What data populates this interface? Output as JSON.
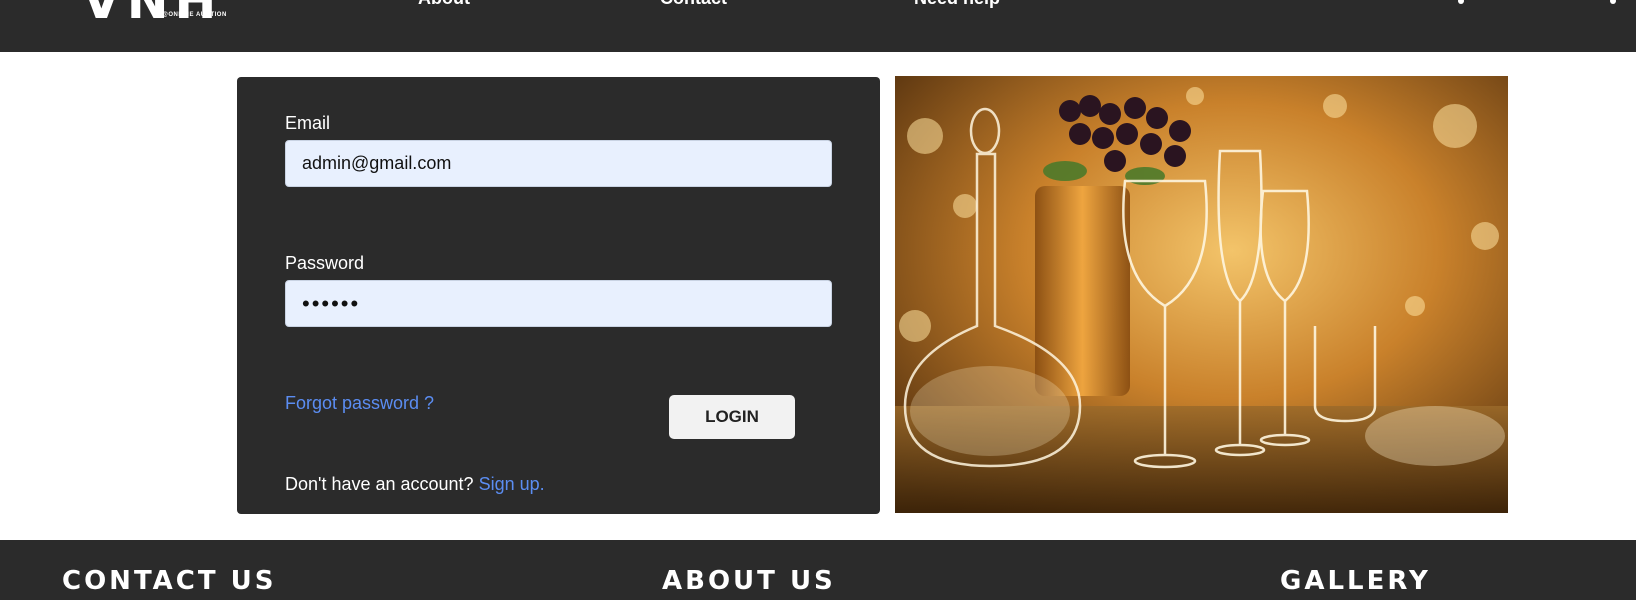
{
  "header": {
    "logo_text": "VNH",
    "logo_tagline": "@ONLINE AUCTION",
    "nav": [
      {
        "label": "About"
      },
      {
        "label": "Contact"
      },
      {
        "label": "Need help"
      }
    ]
  },
  "login_form": {
    "email_label": "Email",
    "email_value": "admin@gmail.com",
    "password_label": "Password",
    "password_value": "••••••",
    "forgot_password": "Forgot password ?",
    "login_button": "LOGIN",
    "no_account_text": "Don't have an account?",
    "signup_link": "Sign up."
  },
  "footer": {
    "contact_heading": "CONTACT US",
    "about_heading": "ABOUT US",
    "gallery_heading": "GALLERY"
  },
  "colors": {
    "dark_bg": "#2b2b2b",
    "link_blue": "#5b8df2",
    "input_bg": "#e8f0fe",
    "button_bg": "#f2f2f2"
  }
}
